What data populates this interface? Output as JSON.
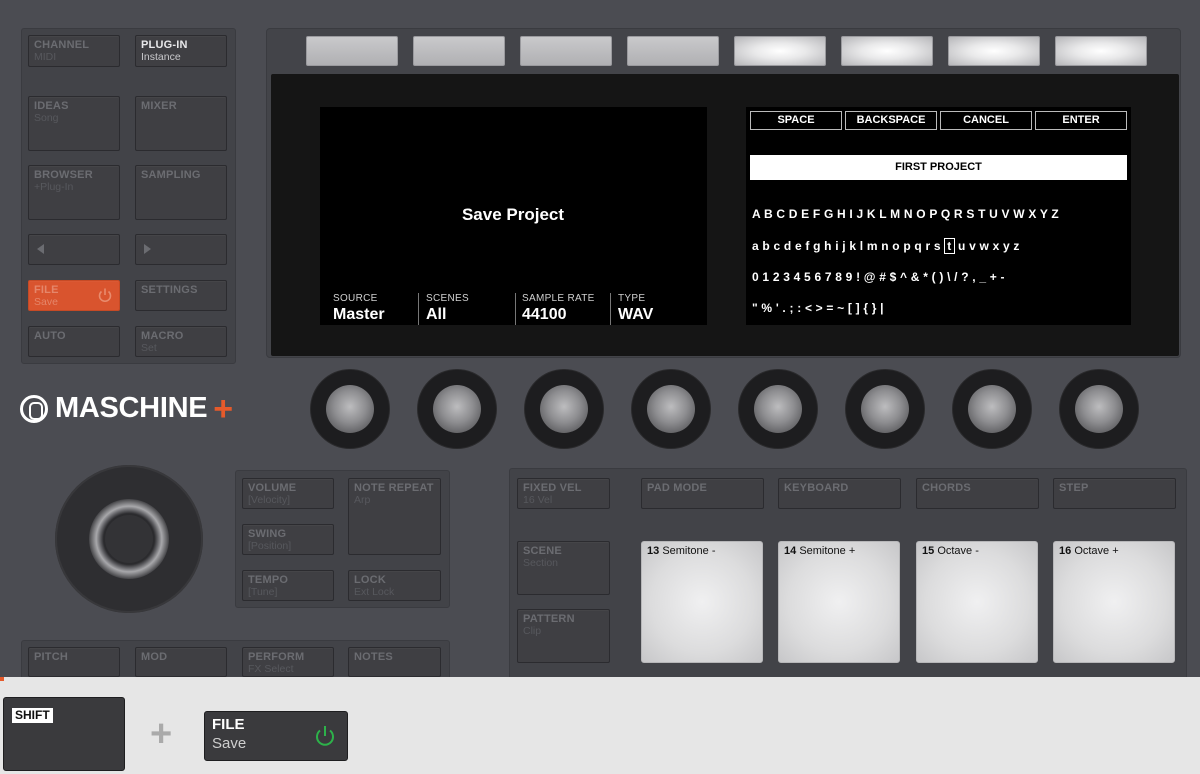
{
  "left_buttons": [
    {
      "name": "channel-button",
      "line1": "CHANNEL",
      "line2": "MIDI",
      "lit": false
    },
    {
      "name": "plugin-button",
      "line1": "PLUG-IN",
      "line2": "Instance",
      "lit": true
    },
    {
      "name": "ideas-button",
      "line1": "IDEAS",
      "line2": "Song",
      "lit": false
    },
    {
      "name": "mixer-button",
      "line1": "MIXER",
      "line2": "",
      "lit": false
    },
    {
      "name": "browser-button",
      "line1": "BROWSER",
      "line2": "+Plug-In",
      "lit": false
    },
    {
      "name": "sampling-button",
      "line1": "SAMPLING",
      "line2": "",
      "lit": false
    },
    {
      "name": "file-button",
      "line1": "FILE",
      "line2": "Save",
      "lit": true
    },
    {
      "name": "settings-button",
      "line1": "SETTINGS",
      "line2": "",
      "lit": false
    },
    {
      "name": "auto-button",
      "line1": "AUTO",
      "line2": "",
      "lit": false
    },
    {
      "name": "macro-button",
      "line1": "MACRO",
      "line2": "Set",
      "lit": false
    }
  ],
  "screen_left": {
    "title": "Save Project",
    "params": [
      {
        "label": "SOURCE",
        "value": "Master"
      },
      {
        "label": "SCENES",
        "value": "All"
      },
      {
        "label": "SAMPLE RATE",
        "value": "44100"
      },
      {
        "label": "TYPE",
        "value": "WAV"
      }
    ]
  },
  "screen_right": {
    "keys": [
      "SPACE",
      "BACKSPACE",
      "CANCEL",
      "ENTER"
    ],
    "name_value": "FIRST PROJECT",
    "row1": "A B C D E F G H I J K L M N O P Q R S T U V W X Y Z",
    "row2_before": "a b c d e f g h i j k l m n o p q r s ",
    "row2_cursor": "t",
    "row2_after": " u v w x y z",
    "row3": "0 1 2 3 4 5 6 7 8 9 ! @ # $ ^ & * ( ) \\ / ? , _ + -",
    "row4": "\" % ' . ; : < > = ~ [ ] { } |"
  },
  "logo": {
    "text": "MASCHINE",
    "plus": "+",
    "accent": "#e55a2b"
  },
  "mid_left_buttons": [
    {
      "name": "volume-button",
      "line1": "VOLUME",
      "line2": "[Velocity]"
    },
    {
      "name": "note-repeat-button",
      "line1": "NOTE REPEAT",
      "line2": "Arp"
    },
    {
      "name": "swing-button",
      "line1": "SWING",
      "line2": "[Position]"
    },
    {
      "name": "tempo-button",
      "line1": "TEMPO",
      "line2": "[Tune]"
    },
    {
      "name": "lock-button",
      "line1": "LOCK",
      "line2": "Ext Lock"
    }
  ],
  "bottom_left_buttons": [
    {
      "name": "pitch-button",
      "line1": "PITCH",
      "line2": ""
    },
    {
      "name": "mod-button",
      "line1": "MOD",
      "line2": ""
    },
    {
      "name": "perform-button",
      "line1": "PERFORM",
      "line2": "FX Select"
    },
    {
      "name": "notes-button",
      "line1": "NOTES",
      "line2": ""
    }
  ],
  "pad_section_buttons": [
    {
      "name": "fixed-vel-button",
      "line1": "FIXED VEL",
      "line2": "16 Vel"
    },
    {
      "name": "pad-mode-button",
      "line1": "PAD MODE",
      "line2": ""
    },
    {
      "name": "keyboard-button",
      "line1": "KEYBOARD",
      "line2": ""
    },
    {
      "name": "chords-button",
      "line1": "CHORDS",
      "line2": ""
    },
    {
      "name": "step-button",
      "line1": "STEP",
      "line2": ""
    },
    {
      "name": "scene-button",
      "line1": "SCENE",
      "line2": "Section"
    },
    {
      "name": "pattern-button",
      "line1": "PATTERN",
      "line2": "Clip"
    }
  ],
  "pads": [
    {
      "num": "13",
      "label": "Semitone -"
    },
    {
      "num": "14",
      "label": "Semitone +"
    },
    {
      "num": "15",
      "label": "Octave -"
    },
    {
      "num": "16",
      "label": "Octave +"
    }
  ],
  "footer": {
    "shift_label": "SHIFT",
    "plus": "+",
    "file_line1": "FILE",
    "file_line2": "Save",
    "power_color": "#2db24a"
  }
}
